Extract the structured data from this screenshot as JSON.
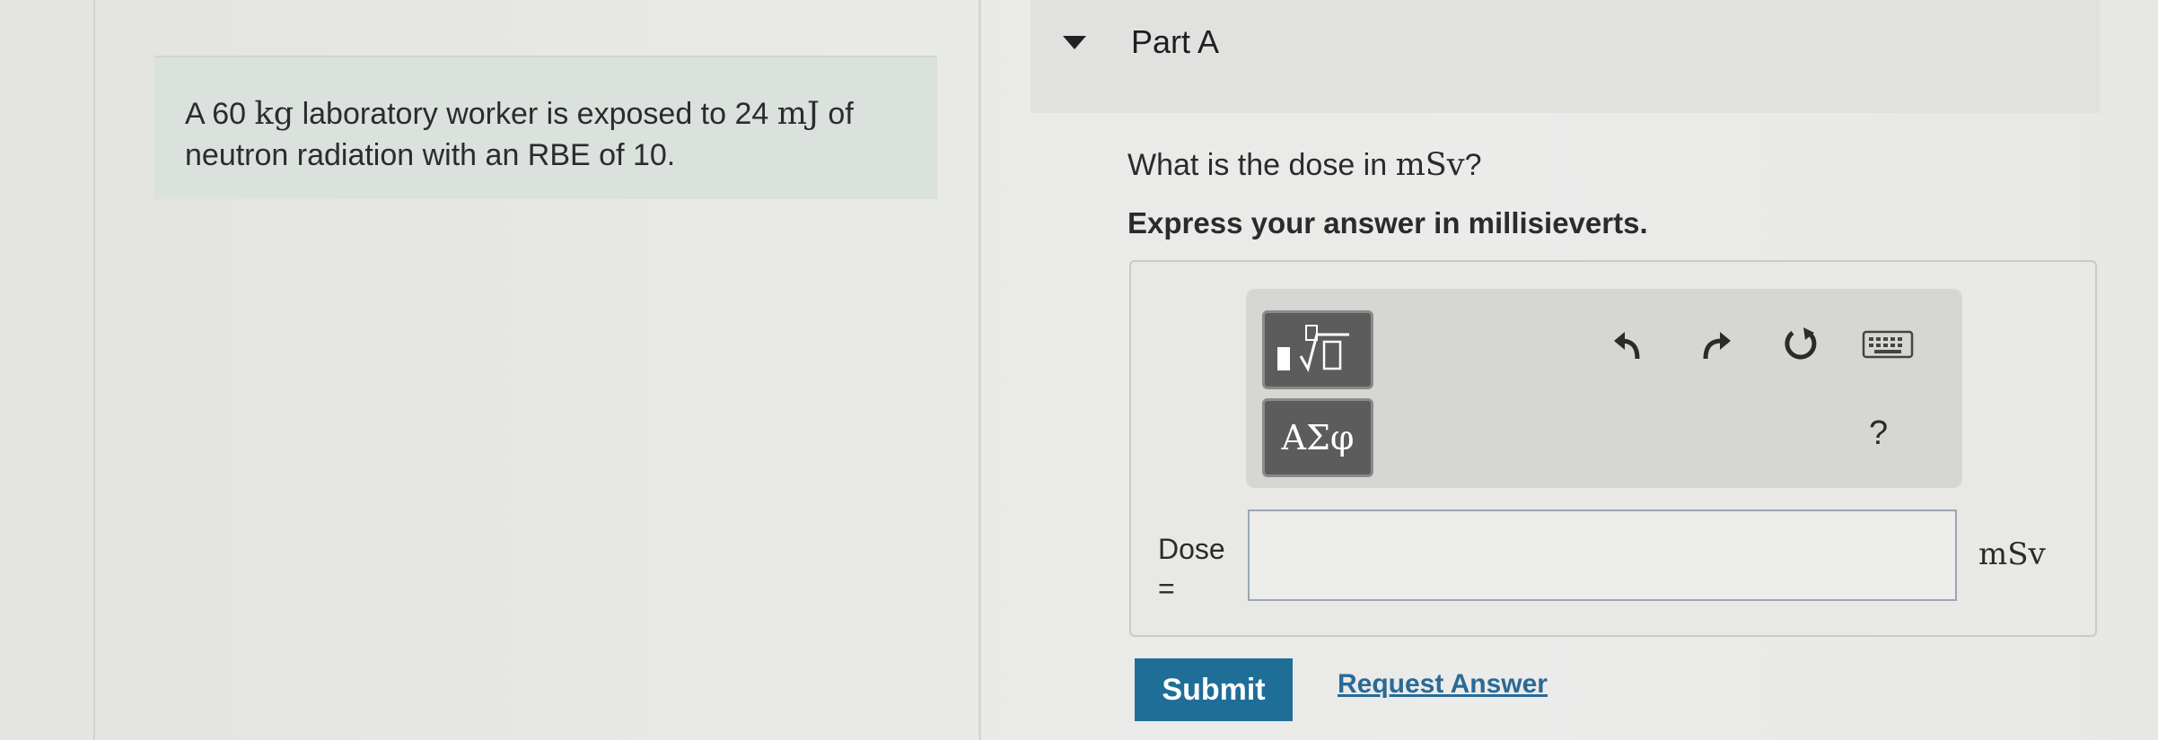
{
  "problem": {
    "part1": "A 60 ",
    "mass_unit": "kg",
    "part2": " laboratory worker is exposed to 24 ",
    "energy_unit": "mJ",
    "part3": " of",
    "line2": "neutron radiation with an RBE of 10."
  },
  "part": {
    "title": "Part A"
  },
  "question": {
    "text": "What is the dose in ",
    "unit": "mSv",
    "end": "?",
    "instruction": "Express your answer in millisieverts."
  },
  "toolbar": {
    "symbols_label": "ΑΣφ",
    "help_label": "?"
  },
  "answer": {
    "label_line1": "Dose",
    "label_line2": "=",
    "value": "",
    "unit": "mSv"
  },
  "actions": {
    "submit_label": "Submit",
    "request_label": "Request Answer"
  },
  "colors": {
    "submit_bg": "#1f6e97",
    "link": "#2a6a96",
    "tool_button": "#5c5c5c"
  }
}
